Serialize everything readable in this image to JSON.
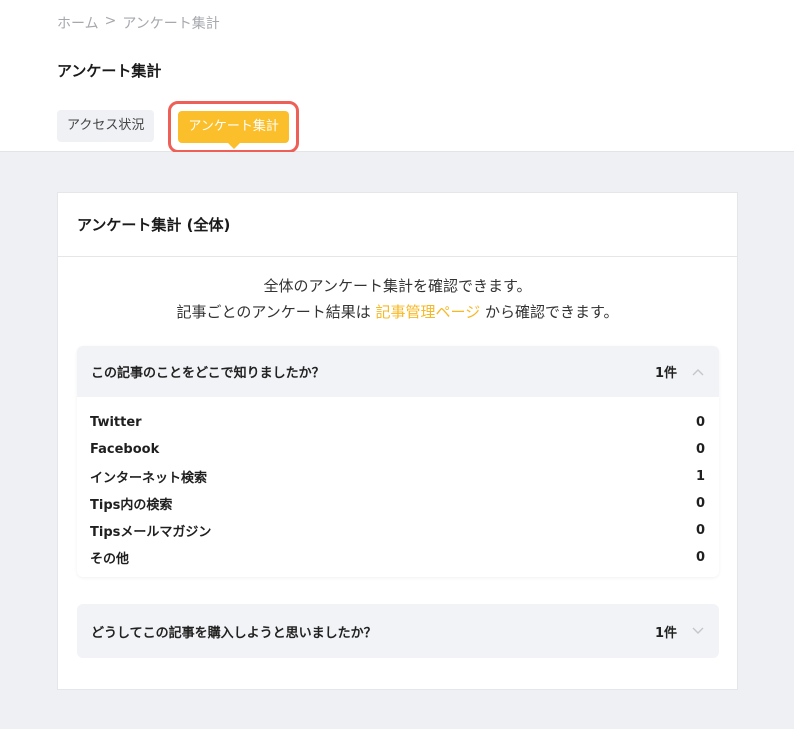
{
  "breadcrumb": {
    "home": "ホーム",
    "sep": ">",
    "current": "アンケート集計"
  },
  "page_title": "アンケート集計",
  "tabs": {
    "access": "アクセス状況",
    "survey": "アンケート集計"
  },
  "card": {
    "title": "アンケート集計 (全体)",
    "intro_line1": "全体のアンケート集計を確認できます。",
    "intro_line2_prefix": "記事ごとのアンケート結果は ",
    "intro_link": "記事管理ページ",
    "intro_line2_suffix": " から確認できます。"
  },
  "questions": [
    {
      "question": "この記事のことをどこで知りましたか？",
      "count": "1件",
      "expanded": true,
      "answers": [
        {
          "label": "Twitter",
          "value": "0"
        },
        {
          "label": "Facebook",
          "value": "0"
        },
        {
          "label": "インターネット検索",
          "value": "1"
        },
        {
          "label": "Tips内の検索",
          "value": "0"
        },
        {
          "label": "Tipsメールマガジン",
          "value": "0"
        },
        {
          "label": "その他",
          "value": "0"
        }
      ]
    },
    {
      "question": "どうしてこの記事を購入しようと思いましたか？",
      "count": "1件",
      "expanded": false
    }
  ],
  "colors": {
    "accent": "#fbbf2b",
    "highlight_border": "#ee5f57",
    "link": "#f6b826",
    "background": "#eef0f4"
  },
  "icons": {
    "expanded": "chevron-up-icon",
    "collapsed": "chevron-down-icon"
  }
}
